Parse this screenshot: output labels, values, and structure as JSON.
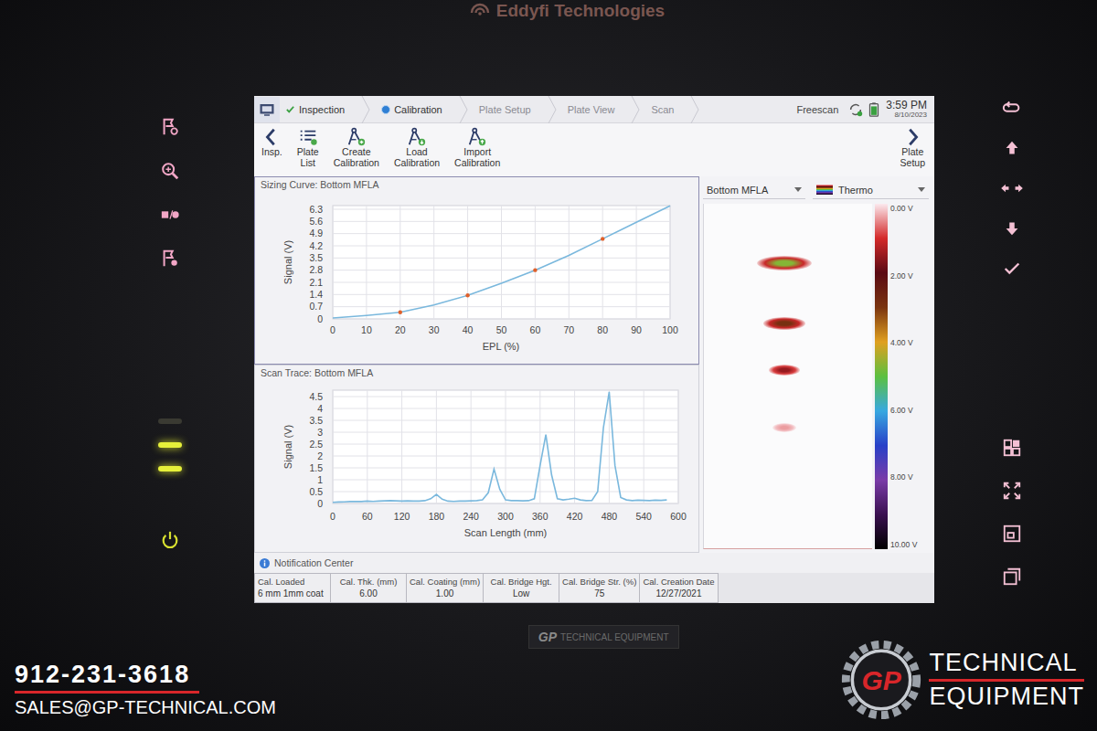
{
  "device": {
    "brand": "Eddyfi Technologies",
    "badge": {
      "mark": "GP",
      "text": "TECHNICAL EQUIPMENT"
    },
    "leds": [
      {
        "on": false
      },
      {
        "on": true
      },
      {
        "on": true
      }
    ]
  },
  "nav": {
    "tabs": [
      {
        "label": "Inspection",
        "selected": false,
        "done": true
      },
      {
        "label": "Calibration",
        "selected": true,
        "done": false
      },
      {
        "label": "Plate Setup",
        "selected": false,
        "done": false
      },
      {
        "label": "Plate View",
        "selected": false,
        "done": false
      },
      {
        "label": "Scan",
        "selected": false,
        "done": false
      }
    ],
    "mode": "Freescan",
    "time": "3:59 PM",
    "date": "8/10/2023"
  },
  "toolbar": {
    "buttons": [
      {
        "label": "Insp.",
        "kind": "back"
      },
      {
        "label": "Plate List",
        "kind": "list"
      },
      {
        "label": "Create Calibration",
        "kind": "create"
      },
      {
        "label": "Load Calibration",
        "kind": "load"
      },
      {
        "label": "Import Calibration",
        "kind": "import"
      }
    ],
    "next": {
      "label": "Plate Setup"
    }
  },
  "sizing_curve": {
    "title": "Sizing Curve: Bottom MFLA",
    "y_label": "Signal (V)",
    "x_label": "EPL (%)",
    "y_ticks": [
      "0",
      "0.7",
      "1.4",
      "2.1",
      "2.8",
      "3.5",
      "4.2",
      "4.9",
      "5.6",
      "6.3"
    ],
    "x_ticks": [
      "0",
      "10",
      "20",
      "30",
      "40",
      "50",
      "60",
      "70",
      "80",
      "90",
      "100"
    ],
    "epl": [
      0,
      10,
      20,
      30,
      40,
      50,
      60,
      70,
      80,
      90,
      100
    ],
    "signal": [
      0.05,
      0.2,
      0.38,
      0.8,
      1.35,
      2.05,
      2.8,
      3.65,
      4.6,
      5.55,
      6.5
    ],
    "marked": [
      false,
      false,
      true,
      false,
      true,
      false,
      true,
      false,
      true,
      false,
      false
    ]
  },
  "scan_trace": {
    "title": "Scan Trace: Bottom MFLA",
    "y_label": "Signal (V)",
    "x_label": "Scan Length (mm)",
    "y_ticks": [
      "0",
      "0.5",
      "1",
      "1.5",
      "2",
      "2.5",
      "3",
      "3.5",
      "4",
      "4.5"
    ],
    "x_ticks": [
      "0",
      "60",
      "120",
      "180",
      "240",
      "300",
      "360",
      "420",
      "480",
      "540",
      "600"
    ],
    "x_start": 0,
    "x_step": 10,
    "values": [
      0.05,
      0.06,
      0.07,
      0.08,
      0.09,
      0.08,
      0.1,
      0.09,
      0.1,
      0.11,
      0.12,
      0.11,
      0.1,
      0.11,
      0.1,
      0.1,
      0.12,
      0.2,
      0.38,
      0.18,
      0.1,
      0.09,
      0.1,
      0.1,
      0.11,
      0.12,
      0.15,
      0.45,
      1.45,
      0.6,
      0.15,
      0.12,
      0.12,
      0.11,
      0.12,
      0.2,
      1.6,
      2.9,
      1.2,
      0.2,
      0.15,
      0.18,
      0.22,
      0.15,
      0.12,
      0.13,
      0.5,
      3.2,
      4.7,
      1.6,
      0.25,
      0.15,
      0.12,
      0.14,
      0.13,
      0.12,
      0.14,
      0.13,
      0.15
    ]
  },
  "cscan": {
    "channel": "Bottom MFLA",
    "palette": "Thermo",
    "scale": [
      "0.00 V",
      "2.00 V",
      "4.00 V",
      "6.00 V",
      "8.00 V",
      "10.00 V"
    ],
    "indications": [
      {
        "scan_mm": 480,
        "signal": 4.7
      },
      {
        "scan_mm": 370,
        "signal": 2.9
      },
      {
        "scan_mm": 285,
        "signal": 1.5
      },
      {
        "scan_mm": 180,
        "signal": 0.4
      }
    ]
  },
  "notification_center": {
    "label": "Notification Center"
  },
  "calibration_info": [
    {
      "header": "Cal. Loaded",
      "value": "6 mm 1mm coat"
    },
    {
      "header": "Cal. Thk. (mm)",
      "value": "6.00"
    },
    {
      "header": "Cal. Coating (mm)",
      "value": "1.00"
    },
    {
      "header": "Cal. Bridge Hgt.",
      "value": "Low"
    },
    {
      "header": "Cal. Bridge Str. (%)",
      "value": "75"
    },
    {
      "header": "Cal. Creation Date",
      "value": "12/27/2021"
    }
  ],
  "overlay": {
    "phone": "912-231-3618",
    "email": "SALES@GP-TECHNICAL.COM",
    "logo": {
      "mark": "GP",
      "line1": "TECHNICAL",
      "line2": "EQUIPMENT"
    }
  }
}
